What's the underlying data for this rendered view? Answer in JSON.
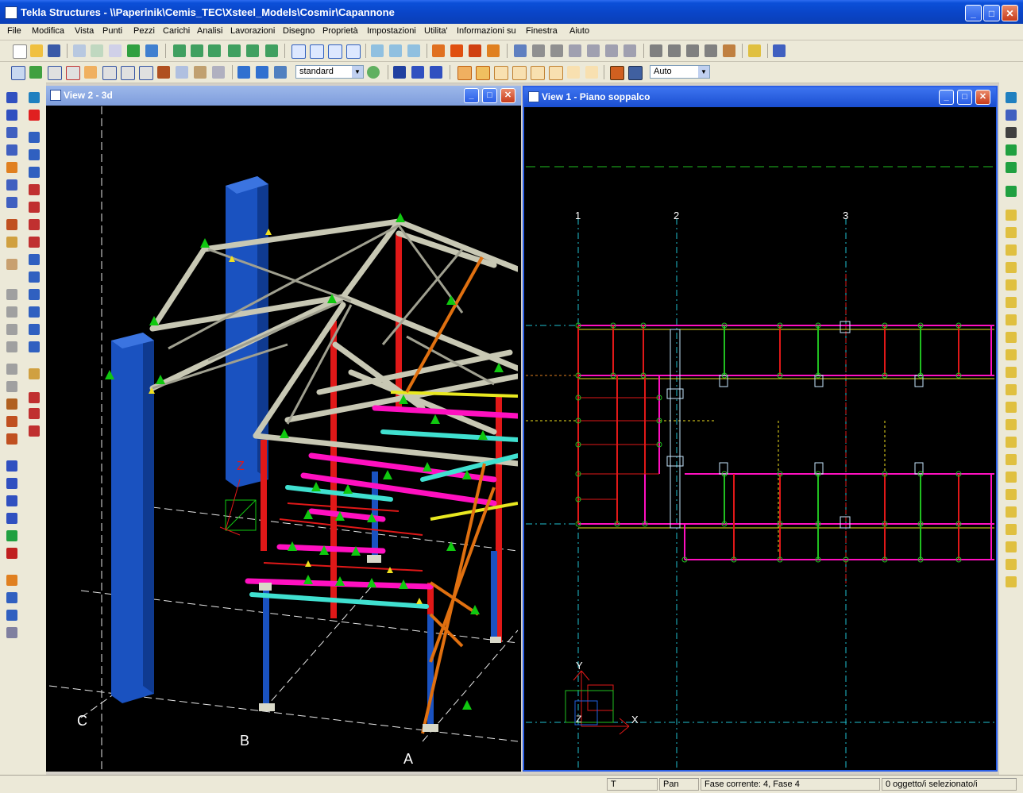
{
  "window": {
    "title": "Tekla Structures - \\\\Paperinik\\Cemis_TEC\\Xsteel_Models\\Cosmir\\Capannone",
    "minimize_glyph": "_",
    "maximize_glyph": "□",
    "close_glyph": "✕"
  },
  "menu": [
    "File",
    "Modifica",
    "Vista",
    "Punti",
    "Pezzi",
    "Carichi",
    "Analisi",
    "Lavorazioni",
    "Disegno",
    "Proprietà",
    "Impostazioni",
    "Utilita'",
    "Informazioni su",
    "Finestra",
    "Aiuto"
  ],
  "toolbar": {
    "view_combo_value": "standard",
    "select_combo_value": "Auto"
  },
  "view3d": {
    "title": "View 2 - 3d",
    "grid_labels": [
      "C",
      "B",
      "A"
    ],
    "axis_label": "Z"
  },
  "viewplan": {
    "title": "View 1  - Piano soppalco",
    "grid_labels": [
      "1",
      "2",
      "3"
    ],
    "axis_x": "X",
    "axis_y": "Y",
    "axis_z": "Z"
  },
  "status": {
    "field1": "T",
    "field2": "Pan",
    "phase": "Fase corrente: 4, Fase 4",
    "selection": "0 oggetto/i selezionato/i"
  },
  "colors": {
    "title_blue": "#0a45c8",
    "beam_grey": "#c8c8b4",
    "column_red": "#e01818",
    "column_blue": "#1a52c0",
    "slab_magenta": "#ff10c0",
    "slab_cyan": "#40e0d0",
    "brace_orange": "#e07010",
    "load_green": "#10c810"
  }
}
